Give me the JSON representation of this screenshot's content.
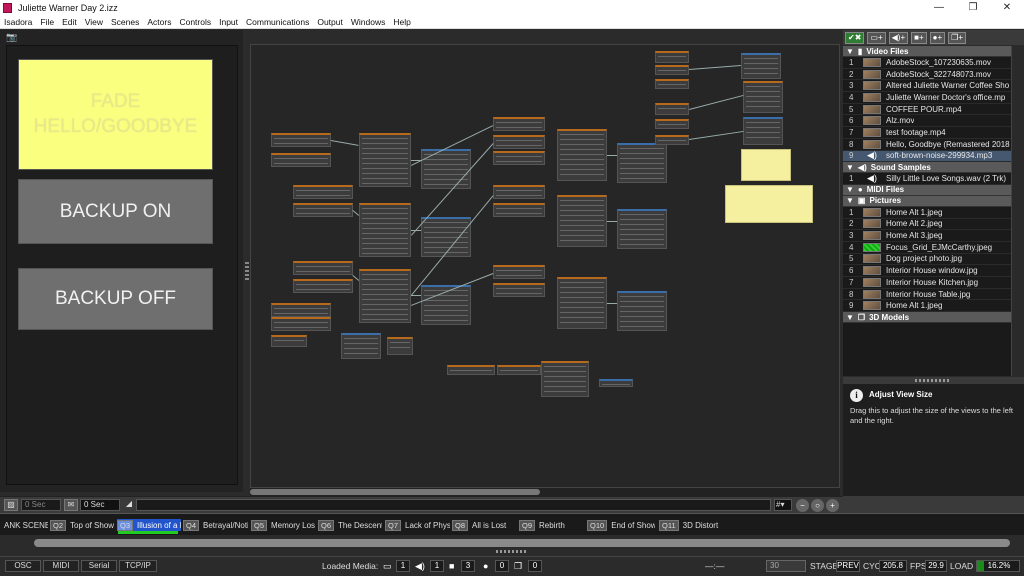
{
  "window": {
    "title": "Juliette Warner Day 2.izz",
    "min": "—",
    "max": "❐",
    "close": "✕"
  },
  "menu": [
    "Isadora",
    "File",
    "Edit",
    "View",
    "Scenes",
    "Actors",
    "Controls",
    "Input",
    "Communications",
    "Output",
    "Windows",
    "Help"
  ],
  "control_buttons": {
    "fade": "FADE HELLO/GOODBYE",
    "backup_on": "BACKUP ON",
    "backup_off": "BACKUP OFF"
  },
  "bottom_toolbar": {
    "field1": "0 Sec",
    "field2": "0 Sec",
    "grid_label": "#▾"
  },
  "media": {
    "video_header": "Video Files",
    "videos": [
      {
        "n": "1",
        "name": "AdobeStock_107230635.mov"
      },
      {
        "n": "2",
        "name": "AdobeStock_322748073.mov"
      },
      {
        "n": "3",
        "name": "Altered Juliette Warner Coffee Sho"
      },
      {
        "n": "4",
        "name": "Juliette Warner Doctor's office.mp"
      },
      {
        "n": "5",
        "name": "COFFEE POUR.mp4"
      },
      {
        "n": "6",
        "name": "Alz.mov"
      },
      {
        "n": "7",
        "name": "test footage.mp4"
      },
      {
        "n": "8",
        "name": "Hello, Goodbye (Remastered 2018"
      },
      {
        "n": "9",
        "name": "soft-brown-noise-299934.mp3"
      }
    ],
    "sound_header": "Sound Samples",
    "sounds": [
      {
        "n": "1",
        "name": "Silly Little Love Songs.wav (2 Trk)"
      }
    ],
    "midi_header": "MIDI Files",
    "pictures_header": "Pictures",
    "pictures": [
      {
        "n": "1",
        "name": "Home Alt 1.jpeg"
      },
      {
        "n": "2",
        "name": "Home Alt 2.jpeg"
      },
      {
        "n": "3",
        "name": "Home Alt 3.jpeg"
      },
      {
        "n": "4",
        "name": "Focus_Grid_EJMcCarthy.jpeg"
      },
      {
        "n": "5",
        "name": "Dog project photo.jpg"
      },
      {
        "n": "6",
        "name": "Interior House window.jpg"
      },
      {
        "n": "7",
        "name": "Interior House Kitchen.jpg"
      },
      {
        "n": "8",
        "name": "Interior House Table.jpg"
      },
      {
        "n": "9",
        "name": "Home Alt 1.jpeg"
      }
    ],
    "models_header": "3D Models"
  },
  "help": {
    "title": "Adjust View Size",
    "body": "Drag this to adjust the size of the views to the left and the right."
  },
  "scenes": [
    {
      "q": "",
      "name": "ANK SCENE!"
    },
    {
      "q": "Q2",
      "name": "Top of Show"
    },
    {
      "q": "Q3",
      "name": "Illusion of a Pe"
    },
    {
      "q": "Q4",
      "name": "Betrayal/Notic"
    },
    {
      "q": "Q5",
      "name": "Memory Loss/"
    },
    {
      "q": "Q6",
      "name": "The Descent"
    },
    {
      "q": "Q7",
      "name": "Lack of Physic"
    },
    {
      "q": "Q8",
      "name": "All is Lost"
    },
    {
      "q": "Q9",
      "name": "Rebirth"
    },
    {
      "q": "Q10",
      "name": "End of Show"
    },
    {
      "q": "Q11",
      "name": "3D Distort"
    }
  ],
  "status": {
    "buttons": [
      "OSC",
      "MIDI",
      "Serial",
      "TCP/IP"
    ],
    "loaded_media_label": "Loaded Media:",
    "counts": [
      "1",
      "1",
      "3",
      "0",
      "0"
    ],
    "stage_label": "STAGE",
    "stage_value": "30",
    "prev": "PREV",
    "cyc_label": "CYC",
    "cyc_value": "205.8",
    "fps_label": "FPS",
    "fps_value": "29.9",
    "load_label": "LOAD",
    "load_value": "16.2%",
    "load_fraction": 0.162
  },
  "colors": {
    "fade_button": "#fbff80",
    "selected_scene": "#2255cc",
    "load_green": "#1d8a1d"
  }
}
